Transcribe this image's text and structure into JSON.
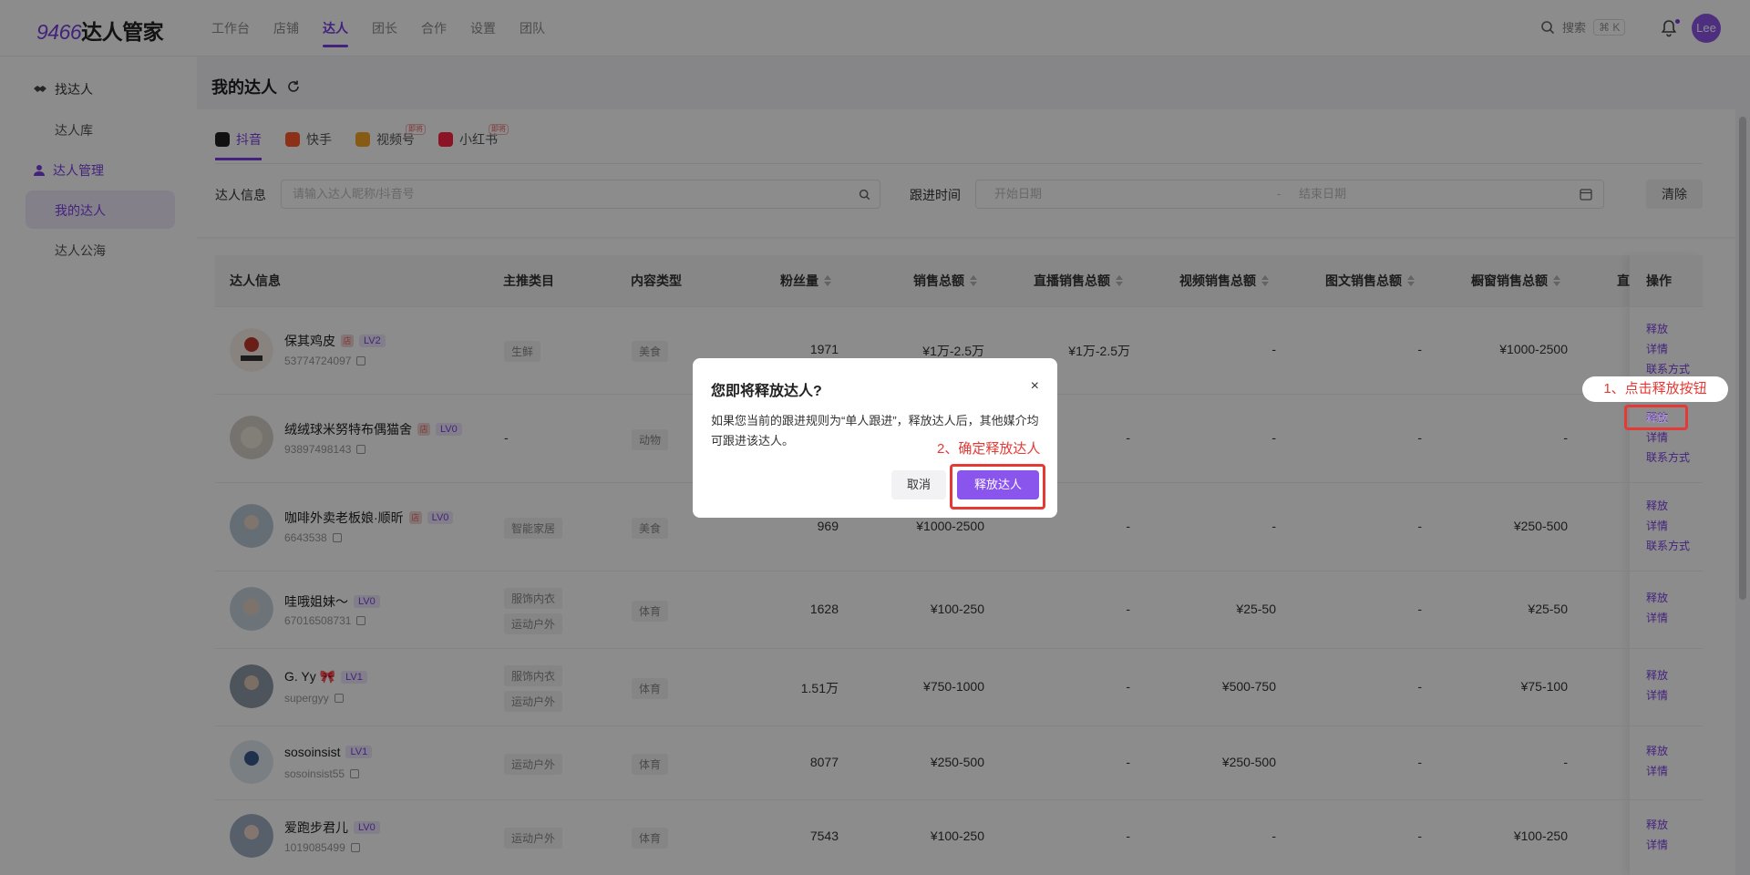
{
  "app": {
    "logo_num": "9466",
    "logo_text": "达人管家",
    "nav": [
      "工作台",
      "店铺",
      "达人",
      "团长",
      "合作",
      "设置",
      "团队"
    ],
    "search_label": "搜索",
    "search_shortcut": "⌘ K",
    "user": "Lee"
  },
  "sidebar": {
    "group1": "找达人",
    "item1": "达人库",
    "group2": "达人管理",
    "item2": "我的达人",
    "item3": "达人公海"
  },
  "page": {
    "title": "我的达人",
    "tabs": [
      {
        "label": "抖音",
        "icon": "douyin-icon"
      },
      {
        "label": "快手",
        "icon": "kuaishou-icon"
      },
      {
        "label": "视频号",
        "icon": "channels-icon",
        "badge": "即将"
      },
      {
        "label": "小红书",
        "icon": "xiaohongshu-icon",
        "badge": "即将"
      }
    ],
    "filter": {
      "talent_label": "达人信息",
      "talent_placeholder": "请输入达人昵称/抖音号",
      "time_label": "跟进时间",
      "start_placeholder": "开始日期",
      "sep": "-",
      "end_placeholder": "结束日期",
      "clear": "清除"
    }
  },
  "table": {
    "columns": [
      "达人信息",
      "主推类目",
      "内容类型",
      "粉丝量",
      "销售总额",
      "直播销售总额",
      "视频销售总额",
      "图文销售总额",
      "橱窗销售总额",
      "直",
      "操作"
    ],
    "rows": [
      {
        "name": "保其鸡皮",
        "level": "LV2",
        "shop": "店",
        "uid": "53774724097",
        "cat": [
          "生鲜"
        ],
        "content": "美食",
        "fans": "1971",
        "sales": "¥1万-2.5万",
        "live": "¥1万-2.5万",
        "video": "-",
        "pic": "-",
        "window": "¥1000-2500",
        "ops": [
          "释放",
          "详情",
          "联系方式"
        ]
      },
      {
        "name": "绒绒球米努特布偶猫舍",
        "level": "LV0",
        "shop": "店",
        "uid": "93897498143",
        "cat": [
          "-"
        ],
        "content": "动物",
        "fans": "",
        "sales": "",
        "live": "-",
        "video": "-",
        "pic": "-",
        "window": "-",
        "ops": [
          "释放",
          "详情",
          "联系方式"
        ]
      },
      {
        "name": "咖啡外卖老板娘·顺昕",
        "level": "LV0",
        "shop": "店",
        "uid": "6643538",
        "cat": [
          "智能家居"
        ],
        "content": "美食",
        "fans": "969",
        "sales": "¥1000-2500",
        "live": "-",
        "video": "-",
        "pic": "-",
        "window": "¥250-500",
        "ops": [
          "释放",
          "详情",
          "联系方式"
        ]
      },
      {
        "name": "哇哦姐妹～",
        "level": "LV0",
        "shop": "",
        "uid": "67016508731",
        "cat": [
          "服饰内衣",
          "运动户外"
        ],
        "content": "体育",
        "fans": "1628",
        "sales": "¥100-250",
        "live": "-",
        "video": "¥25-50",
        "pic": "-",
        "window": "¥25-50",
        "ops": [
          "释放",
          "详情"
        ]
      },
      {
        "name": "G. Yy 🎀",
        "level": "LV1",
        "shop": "",
        "uid": "supergyy",
        "cat": [
          "服饰内衣",
          "运动户外"
        ],
        "content": "体育",
        "fans": "1.51万",
        "sales": "¥750-1000",
        "live": "-",
        "video": "¥500-750",
        "pic": "-",
        "window": "¥75-100",
        "ops": [
          "释放",
          "详情"
        ]
      },
      {
        "name": "sosoinsist",
        "level": "LV1",
        "shop": "",
        "uid": "sosoinsist55",
        "cat": [
          "运动户外"
        ],
        "content": "体育",
        "fans": "8077",
        "sales": "¥250-500",
        "live": "-",
        "video": "¥250-500",
        "pic": "-",
        "window": "-",
        "ops": [
          "释放",
          "详情"
        ]
      },
      {
        "name": "爱跑步君儿",
        "level": "LV0",
        "shop": "",
        "uid": "1019085499",
        "cat": [
          "运动户外"
        ],
        "content": "体育",
        "fans": "7543",
        "sales": "¥100-250",
        "live": "-",
        "video": "-",
        "pic": "-",
        "window": "¥100-250",
        "ops": [
          "释放",
          "详情"
        ]
      }
    ]
  },
  "dialog": {
    "title": "您即将释放达人?",
    "close": "×",
    "body": "如果您当前的跟进规则为“单人跟进”，释放达人后，其他媒介均可跟进该达人。",
    "cancel": "取消",
    "confirm": "释放达人"
  },
  "annotations": {
    "step1": "1、点击释放按钮",
    "step2": "2、确定释放达人",
    "color": "#e53935"
  },
  "colors": {
    "accent": "#7b3fe4",
    "confirm": "#8a55ec"
  }
}
